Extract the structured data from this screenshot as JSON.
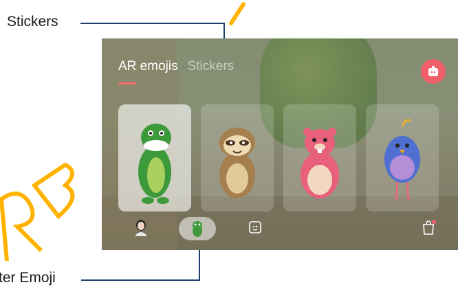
{
  "callouts": {
    "stickers_label": "Stickers",
    "character_emoji_label": "ter Emoji"
  },
  "screen": {
    "tabs": [
      {
        "label": "AR emojis",
        "active": true
      },
      {
        "label": "Stickers",
        "active": false
      }
    ],
    "create_button_icon": "emoji-face-add-icon",
    "cards": [
      {
        "name": "dinosaur",
        "selected": true,
        "icon": "dinosaur-icon"
      },
      {
        "name": "sloth",
        "selected": false,
        "icon": "sloth-icon"
      },
      {
        "name": "pink-beaver",
        "selected": false,
        "icon": "pink-beaver-icon"
      },
      {
        "name": "purple-bird",
        "selected": false,
        "icon": "purple-bird-icon"
      }
    ],
    "bottom_bar": [
      {
        "name": "my-emoji",
        "icon": "person-avatar-icon",
        "selected": false
      },
      {
        "name": "character-emoji",
        "icon": "dinosaur-small-icon",
        "selected": true
      },
      {
        "name": "sticker-gallery",
        "icon": "sticker-frame-icon",
        "selected": false
      },
      {
        "name": "shop",
        "icon": "shopping-bag-icon",
        "selected": false,
        "badge": true
      }
    ]
  },
  "colors": {
    "accent": "#f0606b",
    "callout_line": "#1a3f6b",
    "watermark": "#ffb300"
  }
}
